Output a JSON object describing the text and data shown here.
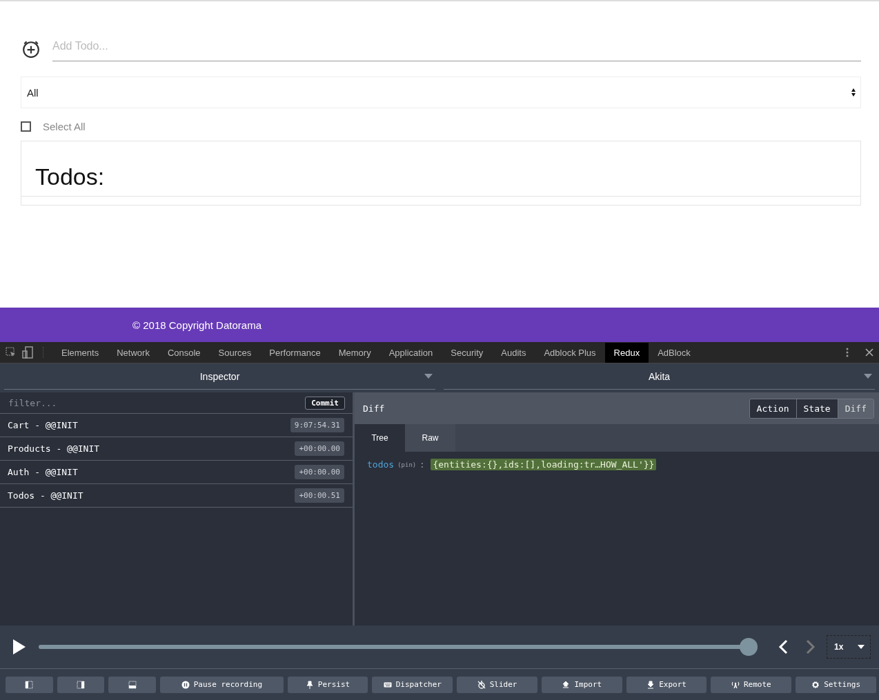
{
  "app": {
    "add_todo": {
      "placeholder": "Add Todo..."
    },
    "filter_select": {
      "value": "All"
    },
    "select_all": {
      "label": "Select All",
      "checked": false
    },
    "todos_title": "Todos:"
  },
  "footer": {
    "copyright": "© 2018 Copyright Datorama"
  },
  "devtools": {
    "tabs": [
      {
        "label": "Elements",
        "selected": false
      },
      {
        "label": "Network",
        "selected": false
      },
      {
        "label": "Console",
        "selected": false
      },
      {
        "label": "Sources",
        "selected": false
      },
      {
        "label": "Performance",
        "selected": false
      },
      {
        "label": "Memory",
        "selected": false
      },
      {
        "label": "Application",
        "selected": false
      },
      {
        "label": "Security",
        "selected": false
      },
      {
        "label": "Audits",
        "selected": false
      },
      {
        "label": "Adblock Plus",
        "selected": false
      },
      {
        "label": "Redux",
        "selected": true
      },
      {
        "label": "AdBlock",
        "selected": false
      }
    ]
  },
  "monitor": {
    "left_title": "Inspector",
    "right_title": "Akita"
  },
  "actions": {
    "filter": {
      "placeholder": "filter..."
    },
    "commit": "Commit",
    "items": [
      {
        "name": "Cart - @@INIT",
        "time": "9:07:54.31"
      },
      {
        "name": "Products - @@INIT",
        "time": "+00:00.00"
      },
      {
        "name": "Auth - @@INIT",
        "time": "+00:00.00"
      },
      {
        "name": "Todos - @@INIT",
        "time": "+00:00.51"
      }
    ]
  },
  "detail": {
    "title": "Diff",
    "modes": [
      {
        "label": "Action",
        "selected": false
      },
      {
        "label": "State",
        "selected": false
      },
      {
        "label": "Diff",
        "selected": true
      }
    ],
    "views": [
      {
        "label": "Tree",
        "selected": true
      },
      {
        "label": "Raw",
        "selected": false
      }
    ],
    "entry": {
      "key": "todos",
      "hint": "(pin)",
      "separator": ":",
      "value": "{entities:{},ids:[],loading:tr…HOW_ALL'}}"
    }
  },
  "playback": {
    "level": 1,
    "previous_disabled": false,
    "next_disabled": true,
    "speed": "1x"
  },
  "toolbar": [
    {
      "kind": "layout-left"
    },
    {
      "kind": "layout-right"
    },
    {
      "kind": "layout-bottom"
    },
    {
      "kind": "pause",
      "label": "Pause recording"
    },
    {
      "kind": "pin",
      "label": "Persist"
    },
    {
      "kind": "keyboard",
      "label": "Dispatcher"
    },
    {
      "kind": "slider",
      "label": "Slider"
    },
    {
      "kind": "import",
      "label": "Import"
    },
    {
      "kind": "export",
      "label": "Export"
    },
    {
      "kind": "remote",
      "label": "Remote"
    },
    {
      "kind": "settings",
      "label": "Settings"
    }
  ]
}
